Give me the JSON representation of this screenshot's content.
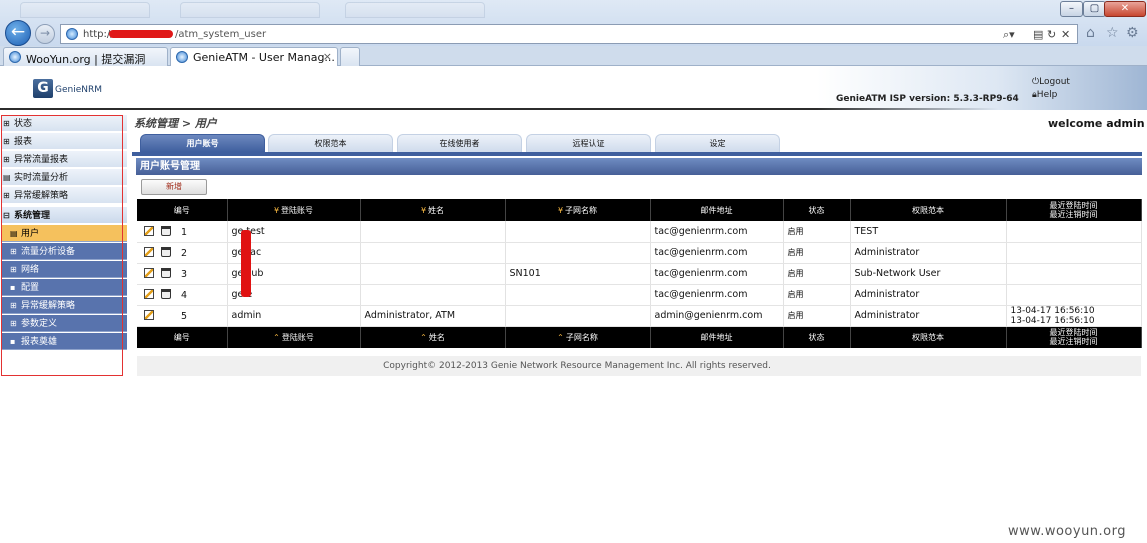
{
  "browser": {
    "address": {
      "prefix": "http://",
      "path": "/atm_system_user"
    },
    "tabs": [
      {
        "label": "WooYun.org | 提交漏洞"
      },
      {
        "label": "GenieATM - User Manag...",
        "close": "×"
      }
    ]
  },
  "header": {
    "logo_text": "GenieNRM",
    "logout_label": "Logout",
    "help_label": "Help",
    "version_text": "GenieATM ISP version: 5.3.3-RP9-64"
  },
  "sidebar": {
    "items": [
      {
        "label": "状态",
        "mark": "⊞"
      },
      {
        "label": "报表",
        "mark": "⊞"
      },
      {
        "label": "异常流量报表",
        "mark": "⊞"
      },
      {
        "label": "实时流量分析",
        "mark": "▤"
      },
      {
        "label": "异常缓解策略",
        "mark": "⊞"
      },
      {
        "label": "系统管理",
        "mark": "⊟"
      },
      {
        "label": "用户",
        "mark": "▤"
      },
      {
        "label": "流量分析设备",
        "mark": "⊞"
      },
      {
        "label": "网络",
        "mark": "⊞"
      },
      {
        "label": "配置",
        "mark": "▪"
      },
      {
        "label": "异常缓解策略",
        "mark": "⊞"
      },
      {
        "label": "参数定义",
        "mark": "⊞"
      },
      {
        "label": "报表奠雄",
        "mark": "▪"
      }
    ]
  },
  "page": {
    "breadcrumb": "系统管理 > 用户",
    "welcome_prefix": "welcome",
    "welcome_user": "admin",
    "tabs": [
      {
        "label": "用户账号"
      },
      {
        "label": "权限范本"
      },
      {
        "label": "在线使用者"
      },
      {
        "label": "远程认证"
      },
      {
        "label": "设定"
      }
    ],
    "section_title": "用户账号管理",
    "add_button": "新增"
  },
  "table": {
    "headers": [
      "编号",
      "登陆账号",
      "姓名",
      "子网名称",
      "邮件地址",
      "状态",
      "权限范本",
      "最近登陆时间",
      "最近注销时间"
    ],
    "rows": [
      {
        "id": "1",
        "account": "ge    test",
        "name": "",
        "subnet": "",
        "email": "tac@genienrm.com",
        "status": "启用",
        "template": "TEST",
        "login": "",
        "logout": ""
      },
      {
        "id": "2",
        "account": "ge    tac",
        "name": "",
        "subnet": "",
        "email": "tac@genienrm.com",
        "status": "启用",
        "template": "Administrator",
        "login": "",
        "logout": ""
      },
      {
        "id": "3",
        "account": "ge    sub",
        "name": "",
        "subnet": "SN101",
        "email": "tac@genienrm.com",
        "status": "启用",
        "template": "Sub-Network User",
        "login": "",
        "logout": ""
      },
      {
        "id": "4",
        "account": "ge    e",
        "name": "",
        "subnet": "",
        "email": "tac@genienrm.com",
        "status": "启用",
        "template": "Administrator",
        "login": "",
        "logout": ""
      },
      {
        "id": "5",
        "account": "admin",
        "name": "Administrator, ATM",
        "subnet": "",
        "email": "admin@genienrm.com",
        "status": "启用",
        "template": "Administrator",
        "login": "13-04-17 16:56:10",
        "logout": "13-04-17 16:56:10"
      }
    ]
  },
  "footer": {
    "copyright": "Copyright© 2012-2013 Genie Network Resource Management Inc. All rights reserved.",
    "watermark": "www.wooyun.org"
  },
  "colors": {
    "nav_blue": "#5873ad",
    "active_item": "#f5c15d",
    "tab_active": "#3f5f9e",
    "table_header": "#000000",
    "redaction": "#e01212"
  }
}
